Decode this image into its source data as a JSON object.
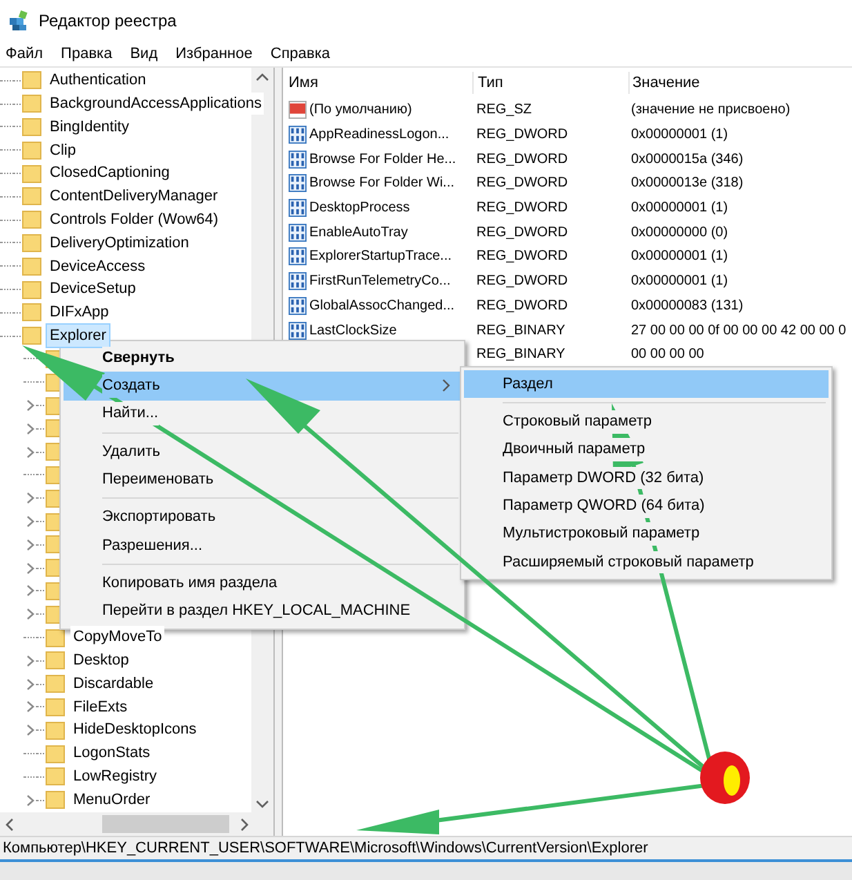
{
  "window": {
    "title": "Редактор реестра"
  },
  "menu": [
    "Файл",
    "Правка",
    "Вид",
    "Избранное",
    "Справка"
  ],
  "tree": [
    {
      "name": "Authentication",
      "expander": false,
      "selected": false
    },
    {
      "name": "BackgroundAccessApplications",
      "expander": false,
      "selected": false
    },
    {
      "name": "BingIdentity",
      "expander": false,
      "selected": false
    },
    {
      "name": "Clip",
      "expander": false,
      "selected": false
    },
    {
      "name": "ClosedCaptioning",
      "expander": false,
      "selected": false
    },
    {
      "name": "ContentDeliveryManager",
      "expander": false,
      "selected": false
    },
    {
      "name": "Controls Folder (Wow64)",
      "expander": false,
      "selected": false
    },
    {
      "name": "DeliveryOptimization",
      "expander": false,
      "selected": false
    },
    {
      "name": "DeviceAccess",
      "expander": false,
      "selected": false
    },
    {
      "name": "DeviceSetup",
      "expander": false,
      "selected": false
    },
    {
      "name": "DIFxApp",
      "expander": false,
      "selected": false
    },
    {
      "name": "Explorer",
      "expander": false,
      "selected": true,
      "children": [
        {
          "expander": false
        },
        {
          "expander": false
        },
        {
          "expander": true
        },
        {
          "expander": true
        },
        {
          "expander": true
        },
        {
          "expander": false
        },
        {
          "expander": true
        },
        {
          "expander": true
        },
        {
          "expander": true
        },
        {
          "expander": true
        },
        {
          "expander": true
        },
        {
          "expander": true
        },
        {
          "name": "CopyMoveTo",
          "expander": false,
          "selected": false
        },
        {
          "name": "Desktop",
          "expander": true,
          "selected": false
        },
        {
          "name": "Discardable",
          "expander": true,
          "selected": false
        },
        {
          "name": "FileExts",
          "expander": true,
          "selected": false
        },
        {
          "name": "HideDesktopIcons",
          "expander": true,
          "selected": false
        },
        {
          "name": "LogonStats",
          "expander": false,
          "selected": false
        },
        {
          "name": "LowRegistry",
          "expander": false,
          "selected": false
        },
        {
          "name": "MenuOrder",
          "expander": true,
          "selected": false
        }
      ]
    }
  ],
  "table": {
    "columns": [
      "Имя",
      "Тип",
      "Значение"
    ],
    "rows": [
      {
        "kind": "string",
        "name": "(По умолчанию)",
        "type": "REG_SZ",
        "value": "(значение не присвоено)"
      },
      {
        "kind": "binary",
        "name": "AppReadinessLogon...",
        "type": "REG_DWORD",
        "value": "0x00000001 (1)"
      },
      {
        "kind": "binary",
        "name": "Browse For Folder He...",
        "type": "REG_DWORD",
        "value": "0x0000015a (346)"
      },
      {
        "kind": "binary",
        "name": "Browse For Folder Wi...",
        "type": "REG_DWORD",
        "value": "0x0000013e (318)"
      },
      {
        "kind": "binary",
        "name": "DesktopProcess",
        "type": "REG_DWORD",
        "value": "0x00000001 (1)"
      },
      {
        "kind": "binary",
        "name": "EnableAutoTray",
        "type": "REG_DWORD",
        "value": "0x00000000 (0)"
      },
      {
        "kind": "binary",
        "name": "ExplorerStartupTrace...",
        "type": "REG_DWORD",
        "value": "0x00000001 (1)"
      },
      {
        "kind": "binary",
        "name": "FirstRunTelemetryCo...",
        "type": "REG_DWORD",
        "value": "0x00000001 (1)"
      },
      {
        "kind": "binary",
        "name": "GlobalAssocChanged...",
        "type": "REG_DWORD",
        "value": "0x00000083 (131)"
      },
      {
        "kind": "binary",
        "name": "LastClockSize",
        "type": "REG_BINARY",
        "value": "27 00 00 00 0f 00 00 00 42 00 00 0"
      },
      {
        "kind": "hidden",
        "type": "REG_BINARY",
        "value": "00 00 00 00"
      }
    ]
  },
  "context_menu": {
    "items": [
      {
        "kind": "item",
        "label": "Свернуть",
        "bold": true,
        "selected": false
      },
      {
        "kind": "item",
        "label": "Создать",
        "submenu": true,
        "selected": true
      },
      {
        "kind": "item",
        "label": "Найти...",
        "selected": false
      },
      {
        "kind": "separator"
      },
      {
        "kind": "item",
        "label": "Удалить",
        "selected": false
      },
      {
        "kind": "item",
        "label": "Переименовать",
        "selected": false
      },
      {
        "kind": "separator"
      },
      {
        "kind": "item",
        "label": "Экспортировать",
        "selected": false
      },
      {
        "kind": "item",
        "label": "Разрешения...",
        "selected": false
      },
      {
        "kind": "separator"
      },
      {
        "kind": "item",
        "label": "Копировать имя раздела",
        "selected": false
      },
      {
        "kind": "item",
        "label": "Перейти в раздел HKEY_LOCAL_MACHINE",
        "selected": false
      }
    ]
  },
  "submenu": {
    "items": [
      {
        "kind": "item",
        "label": "Раздел",
        "selected": true
      },
      {
        "kind": "separator"
      },
      {
        "kind": "item",
        "label": "Строковый параметр",
        "selected": false
      },
      {
        "kind": "item",
        "label": "Двоичный параметр",
        "selected": false
      },
      {
        "kind": "item",
        "label": "Параметр DWORD (32 бита)",
        "selected": false
      },
      {
        "kind": "item",
        "label": "Параметр QWORD (64 бита)",
        "selected": false
      },
      {
        "kind": "item",
        "label": "Мультистроковый параметр",
        "selected": false
      },
      {
        "kind": "item",
        "label": "Расширяемый строковый параметр",
        "selected": false
      }
    ]
  },
  "status_bar": "Компьютер\\HKEY_CURRENT_USER\\SOFTWARE\\Microsoft\\Windows\\CurrentVersion\\Explorer"
}
